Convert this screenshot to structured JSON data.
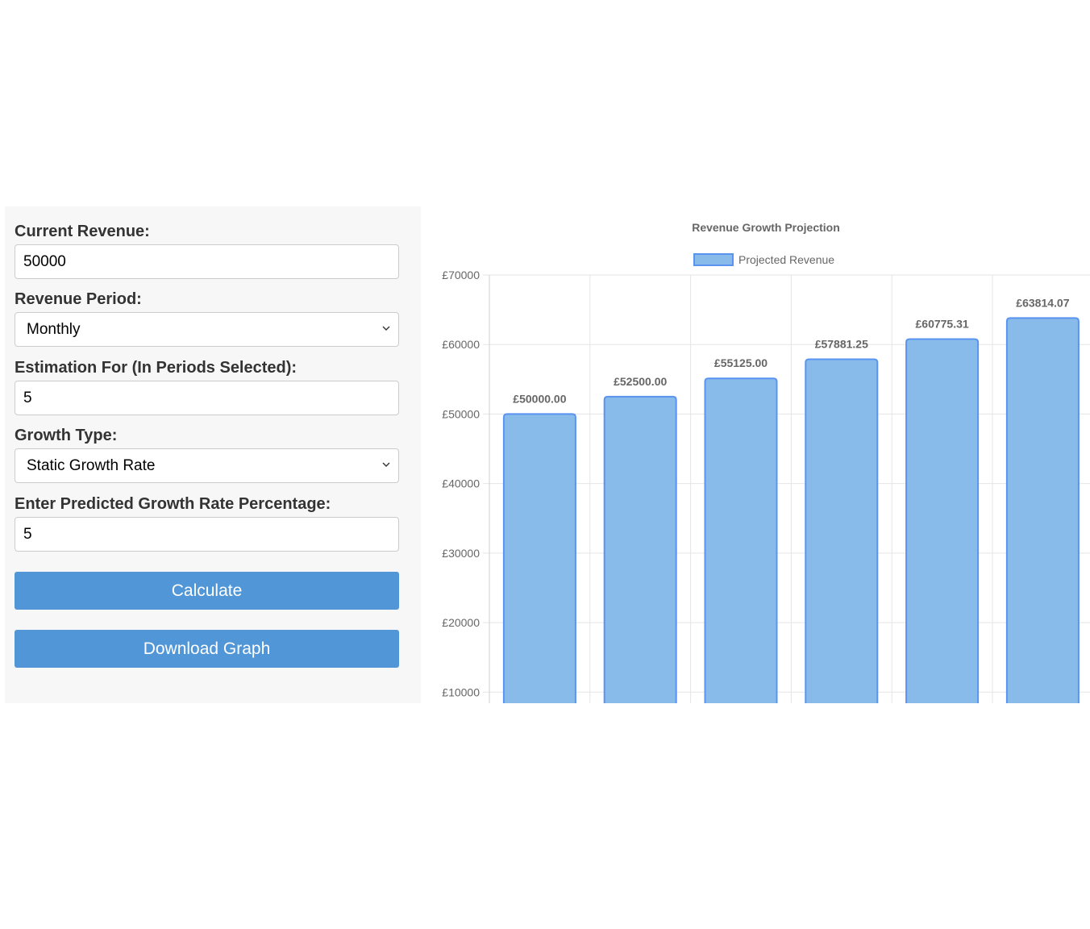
{
  "form": {
    "current_revenue_label": "Current Revenue:",
    "current_revenue_value": "50000",
    "revenue_period_label": "Revenue Period:",
    "revenue_period_value": "Monthly",
    "estimation_label": "Estimation For (In Periods Selected):",
    "estimation_value": "5",
    "growth_type_label": "Growth Type:",
    "growth_type_value": "Static Growth Rate",
    "growth_rate_label": "Enter Predicted Growth Rate Percentage:",
    "growth_rate_value": "5",
    "calculate_label": "Calculate",
    "download_label": "Download Graph"
  },
  "chart_data": {
    "type": "bar",
    "title": "Revenue Growth Projection",
    "legend": "Projected Revenue",
    "legend_placement": "top",
    "grid": true,
    "series": [
      {
        "name": "Projected Revenue",
        "values": [
          50000.0,
          52500.0,
          55125.0,
          57881.25,
          60775.31,
          63814.07
        ]
      }
    ],
    "data_labels": [
      "£50000.00",
      "£52500.00",
      "£55125.00",
      "£57881.25",
      "£60775.31",
      "£63814.07"
    ],
    "y_ticks": [
      "£10000",
      "£20000",
      "£30000",
      "£40000",
      "£50000",
      "£60000",
      "£70000"
    ],
    "y_tick_values": [
      10000,
      20000,
      30000,
      40000,
      50000,
      60000,
      70000
    ],
    "ylim": [
      0,
      70000
    ],
    "bar_fill": "#89bbea",
    "bar_border": "#5a94f0"
  }
}
